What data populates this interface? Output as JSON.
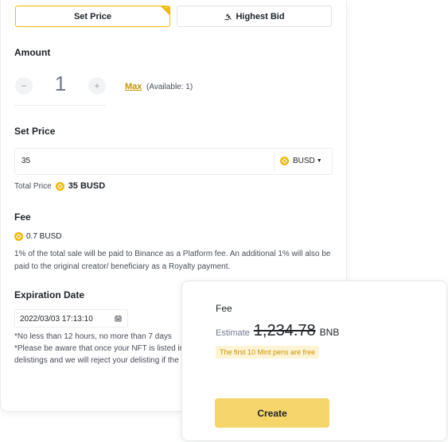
{
  "tabs": {
    "set_price": "Set Price",
    "highest_bid": "Highest Bid"
  },
  "amount": {
    "title": "Amount",
    "minus": "−",
    "value": "1",
    "plus": "+",
    "max": "Max",
    "available": "(Available: 1)"
  },
  "set_price": {
    "title": "Set Price",
    "value": "35",
    "currency": "BUSD",
    "total_label": "Total Price",
    "total_value": "35 BUSD"
  },
  "fee": {
    "title": "Fee",
    "value": "0.7 BUSD",
    "description": "1% of the total sale will be paid to Binance as a Platform fee. An additional 1% will also be paid to the original creator/ beneficiary as a Royalty payment."
  },
  "expiration": {
    "title": "Expiration Date",
    "value": "2022/03/03 17:13:10",
    "note1": "*No less than 12 hours, no more than 7 days",
    "note2": "*Please be aware that once your NFT is listed in",
    "note3": "delistings and we will reject your delisting if the"
  },
  "fee_card": {
    "title": "Fee",
    "estimate_label": "Estimate",
    "estimate_value": "1,234.78",
    "estimate_unit": "BNB",
    "promo": "The first 10 Mint pens are free",
    "create": "Create"
  },
  "colors": {
    "accent": "#f0b90b",
    "button": "#f6d56a",
    "link": "#c99400"
  },
  "icons": {
    "tab_selected": "check-corner-icon",
    "highest_bid": "gavel-icon",
    "currency": "busd-coin-icon",
    "dropdown": "caret-down-icon",
    "calendar": "calendar-icon"
  }
}
